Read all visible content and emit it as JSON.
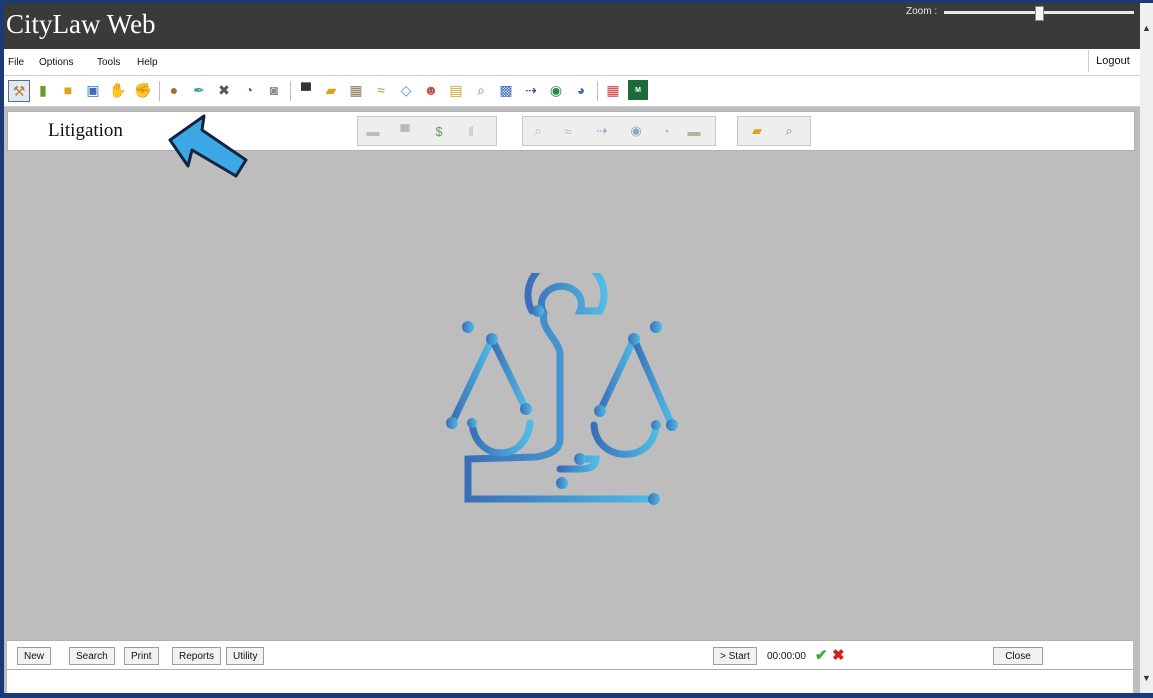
{
  "app": {
    "title": "CityLaw Web"
  },
  "zoom": {
    "label": "Zoom :",
    "level": 0.5
  },
  "menu": {
    "file": "File",
    "options": "Options",
    "tools": "Tools",
    "help": "Help",
    "logout": "Logout"
  },
  "module": {
    "title": "Litigation"
  },
  "bottom": {
    "new": "New",
    "search": "Search",
    "print": "Print",
    "reports": "Reports",
    "utility": "Utility",
    "start": "> Start",
    "timer": "00:00:00",
    "close": "Close"
  },
  "toolbar": {
    "icons": [
      "gavel-icon",
      "book-icon",
      "folders-icon",
      "lock-icon",
      "hand-icon",
      "handshake-icon",
      "money-bag-icon",
      "pen-icon",
      "tools-icon",
      "stopwatch-icon",
      "clock-icon",
      "printer-icon",
      "folder-icon",
      "map-icon",
      "signature-icon",
      "eraser-icon",
      "person-icon",
      "clipboard-icon",
      "magnifier-icon",
      "contacts-icon",
      "arrow-icon",
      "globe-icon",
      "schedule-icon",
      "grid-icon",
      "msf-icon"
    ]
  },
  "colors": {
    "accent": "#3da8e6",
    "logo_start": "#3a6fb8",
    "logo_end": "#4fbbe6"
  }
}
